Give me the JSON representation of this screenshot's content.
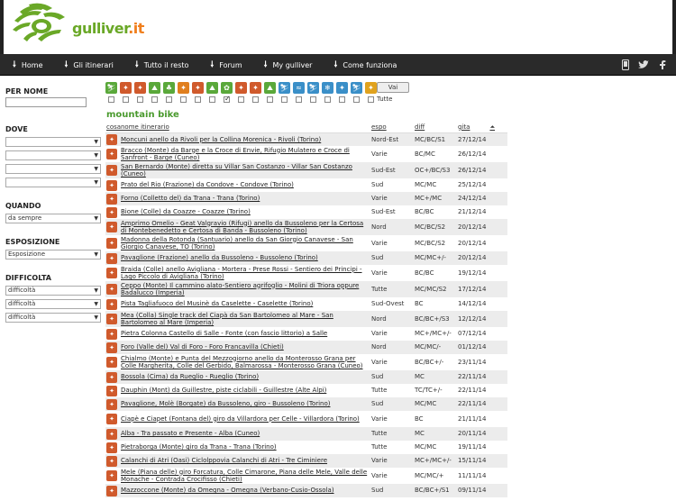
{
  "logo": {
    "text_main": "gulliver",
    "text_dot": ".it"
  },
  "nav": {
    "items": [
      "Home",
      "Gli itinerari",
      "Tutto il resto",
      "Forum",
      "My gulliver",
      "Come funziona"
    ]
  },
  "sidebar": {
    "per_nome": "PER NOME",
    "dove": "DOVE",
    "quando": "QUANDO",
    "quando_value": "da sempre",
    "esposizione": "ESPOSIZIONE",
    "esposizione_value": "Esposizione",
    "difficolta": "DIFFICOLTA",
    "difficolta_values": [
      "difficoltà",
      "difficoltà",
      "difficoltà"
    ]
  },
  "filters": {
    "vai": "Vai",
    "tutte": "Tutte",
    "activity_icons": [
      {
        "color": "#5aa83a",
        "glyph": "⛷"
      },
      {
        "color": "#d05a2c",
        "glyph": "✦"
      },
      {
        "color": "#d05a2c",
        "glyph": "✦"
      },
      {
        "color": "#5aa83a",
        "glyph": "⛰"
      },
      {
        "color": "#5aa83a",
        "glyph": "♣"
      },
      {
        "color": "#e07f1e",
        "glyph": "✦"
      },
      {
        "color": "#d05a2c",
        "glyph": "✦"
      },
      {
        "color": "#5aa83a",
        "glyph": "⛰"
      },
      {
        "color": "#5aa83a",
        "glyph": "✿"
      },
      {
        "color": "#d05a2c",
        "glyph": "✦"
      },
      {
        "color": "#d05a2c",
        "glyph": "✦"
      },
      {
        "color": "#5aa83a",
        "glyph": "⛰"
      },
      {
        "color": "#3a8fc8",
        "glyph": "⛷"
      },
      {
        "color": "#3a8fc8",
        "glyph": "≈"
      },
      {
        "color": "#3a8fc8",
        "glyph": "⛷"
      },
      {
        "color": "#3a8fc8",
        "glyph": "❄"
      },
      {
        "color": "#3a8fc8",
        "glyph": "✦"
      },
      {
        "color": "#3a8fc8",
        "glyph": "⛷"
      },
      {
        "color": "#e0a21e",
        "glyph": "✦"
      }
    ],
    "checked_index": 8
  },
  "section_title": "mountain bike",
  "table": {
    "headers": [
      "cosa",
      "nome itinerario",
      "espo",
      "diff",
      "gita"
    ],
    "sort_arrow": "⏶",
    "rows": [
      {
        "name": "Moncuni anello da Rivoli per la Collina Morenica - Rivoli (Torino)",
        "espo": "Nord-Est",
        "diff": "MC/BC/S1",
        "gita": "27/12/14"
      },
      {
        "name": "Bracco (Monte) da Barge e la Croce di Envie, Rifugio Mulatero e Croce di Sanfront - Barge (Cuneo)",
        "espo": "Varie",
        "diff": "BC/MC",
        "gita": "26/12/14"
      },
      {
        "name": "San Bernardo (Monte) diretta su Villar San Costanzo - Villar San Costanzo (Cuneo)",
        "espo": "Sud-Est",
        "diff": "OC+/BC/S3",
        "gita": "26/12/14"
      },
      {
        "name": "Prato del Rio (Frazione) da Condove - Condove (Torino)",
        "espo": "Sud",
        "diff": "MC/MC",
        "gita": "25/12/14"
      },
      {
        "name": "Forno (Colletto del) da Trana - Trana (Torino)",
        "espo": "Varie",
        "diff": "MC+/MC",
        "gita": "24/12/14"
      },
      {
        "name": "Bione (Colle) da Coazze - Coazze (Torino)",
        "espo": "Sud-Est",
        "diff": "BC/BC",
        "gita": "21/12/14"
      },
      {
        "name": "Amprimo Omelio - Geat Valgravio (Rifugi) anello da Bussoleno per la Certosa di Montebenedetto e Certosa di Banda - Bussoleno (Torino)",
        "espo": "Nord",
        "diff": "MC/BC/S2",
        "gita": "20/12/14"
      },
      {
        "name": "Madonna della Rotonda (Santuario) anello da San Giorgio Canavese - San Giorgio Canavese, TO (Torino)",
        "espo": "Varie",
        "diff": "MC/BC/S2",
        "gita": "20/12/14"
      },
      {
        "name": "Pavaglione (Frazione) anello da Bussoleno - Bussoleno (Torino)",
        "espo": "Sud",
        "diff": "MC/MC+/-",
        "gita": "20/12/14"
      },
      {
        "name": "Braida (Colle) anello Avigliana - Mortera - Prese Rossi - Sentiero dei Principi - Lago Piccolo di Avigliana (Torino)",
        "espo": "Varie",
        "diff": "BC/BC",
        "gita": "19/12/14"
      },
      {
        "name": "Ceppo (Monte) Il cammino alato-Sentiero agrifoglio - Molini di Triora oppure Badalucco (Imperia)",
        "espo": "Tutte",
        "diff": "MC/MC/S2",
        "gita": "17/12/14"
      },
      {
        "name": "Pista Tagliafuoco del Musinè da Caselette - Caselette (Torino)",
        "espo": "Sud-Ovest",
        "diff": "BC",
        "gita": "14/12/14"
      },
      {
        "name": "Mea (Colla) Single track del Ciapà da San Bartolomeo al Mare - San Bartolomeo al Mare (Imperia)",
        "espo": "Nord",
        "diff": "BC/BC+/S3",
        "gita": "12/12/14"
      },
      {
        "name": "Pietra Colonna Castello di Salle - Fonte (con fascio littorio) a Salle",
        "espo": "Varie",
        "diff": "MC+/MC+/-",
        "gita": "07/12/14"
      },
      {
        "name": "Foro (Valle del) Val di Foro - Foro Francavilla (Chieti)",
        "espo": "Nord",
        "diff": "MC/MC/-",
        "gita": "01/12/14"
      },
      {
        "name": "Chialmo (Monte) e Punta del Mezzogiorno anello da Monterosso Grana per Colle Margherita, Colle del Gerbido, Balmarossa - Monterosso Grana (Cuneo)",
        "espo": "Varie",
        "diff": "BC/BC+/-",
        "gita": "23/11/14"
      },
      {
        "name": "Bossola (Cima) da Rueglio - Rueglio (Torino)",
        "espo": "Sud",
        "diff": "MC",
        "gita": "22/11/14"
      },
      {
        "name": "Dauphin (Mont) da Guillestre, piste ciclabili - Guillestre (Alte Alpi)",
        "espo": "Tutte",
        "diff": "TC/TC+/-",
        "gita": "22/11/14"
      },
      {
        "name": "Pavaglione, Molè (Borgate) da Bussoleno, giro - Bussoleno (Torino)",
        "espo": "Sud",
        "diff": "MC/MC",
        "gita": "22/11/14"
      },
      {
        "name": "Ciapè e Ciapet (Fontana del) giro da Villardora per Celle - Villardora (Torino)",
        "espo": "Varie",
        "diff": "BC",
        "gita": "21/11/14"
      },
      {
        "name": "Alba - Tra passato e Presente - Alba (Cuneo)",
        "espo": "Tutte",
        "diff": "MC",
        "gita": "20/11/14"
      },
      {
        "name": "Pietraborga (Monte) giro da Trana - Trana (Torino)",
        "espo": "Tutte",
        "diff": "MC/MC",
        "gita": "19/11/14"
      },
      {
        "name": "Calanchi di Atri (Oasi) Ciclolppovia Calanchi di Atri - Tre Ciminiere",
        "espo": "Varie",
        "diff": "MC+/MC+/-",
        "gita": "15/11/14"
      },
      {
        "name": "Mele (Piana delle) giro Forcatura, Colle Cimarone, Piana delle Mele, Valle delle Monache - Contrada Crocifisso (Chieti)",
        "espo": "Varie",
        "diff": "MC/MC/+",
        "gita": "11/11/14"
      },
      {
        "name": "Mazzoccone (Monte) da Omegna - Omegna (Verbano-Cusio-Ossola)",
        "espo": "Sud",
        "diff": "BC/BC+/S1",
        "gita": "09/11/14"
      }
    ]
  }
}
